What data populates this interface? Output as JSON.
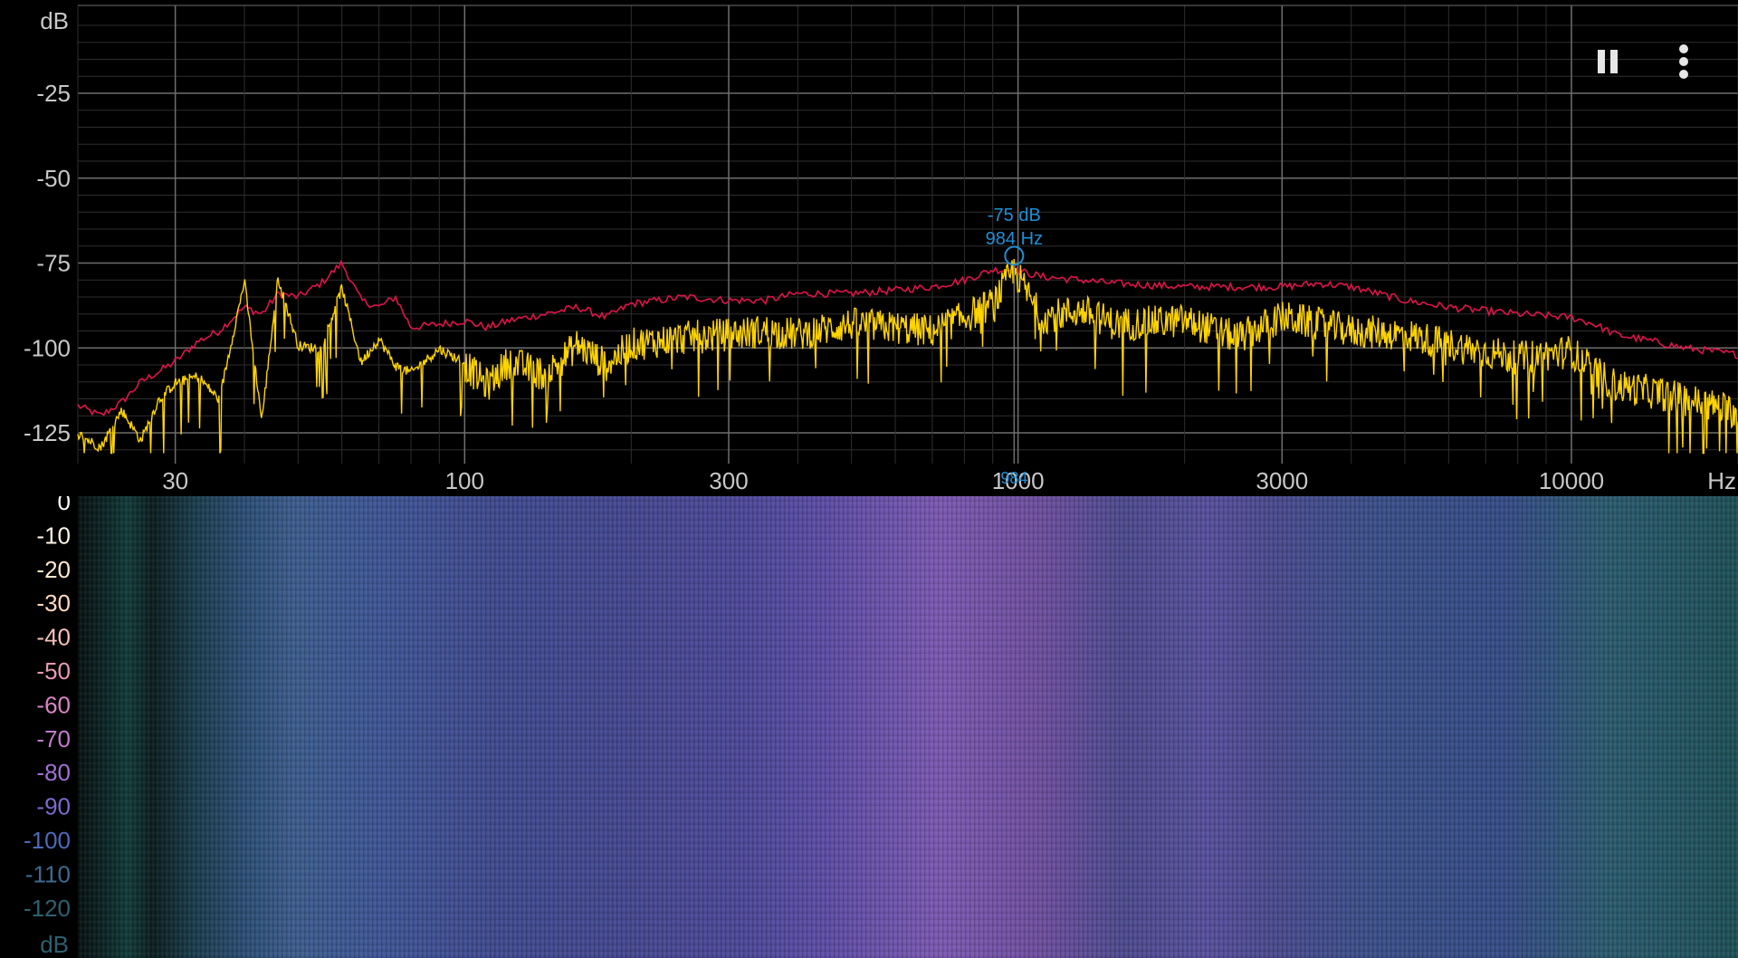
{
  "colors": {
    "peak_hold": "#e0134a",
    "spectrum": "#ffd400",
    "cursor": "#1e90d6",
    "grid_major": "#6e6e6e",
    "grid_minor": "#2e2e2e",
    "axis_text": "#c8c8c8"
  },
  "spectrum": {
    "y_unit": "dB",
    "x_unit": "Hz",
    "y_ticks": [
      "-25",
      "-50",
      "-75",
      "-100",
      "-125"
    ],
    "x_ticks": [
      "30",
      "100",
      "300",
      "1000",
      "3000",
      "10000"
    ],
    "cursor": {
      "db_label": "-75 dB",
      "hz_label": "984 Hz",
      "axis_marker": "984"
    }
  },
  "spectrogram": {
    "scale_labels": [
      "0",
      "-10",
      "-20",
      "-30",
      "-40",
      "-50",
      "-60",
      "-70",
      "-80",
      "-90",
      "-100",
      "-110",
      "-120"
    ],
    "unit": "dB",
    "scale_colors": [
      "#ffffff",
      "#fff6e8",
      "#ffe8d0",
      "#ffd8c0",
      "#f6c0b8",
      "#e89ab8",
      "#d884c4",
      "#c07ccc",
      "#a070d4",
      "#7c6ad0",
      "#4e6aba",
      "#3e6a90",
      "#2e6070"
    ]
  },
  "controls": {
    "pause_icon": "pause-icon",
    "menu_icon": "more-vert-icon"
  },
  "chart_data": {
    "type": "line",
    "xlabel": "Hz",
    "ylabel": "dB",
    "xscale": "log",
    "xlim": [
      20,
      20000
    ],
    "ylim": [
      -130,
      0
    ],
    "series": [
      {
        "x": [
          20,
          22,
          24,
          26,
          28,
          30,
          33,
          36,
          40,
          43,
          46,
          50,
          55,
          60,
          65,
          70,
          75,
          80,
          90,
          100,
          110,
          120,
          140,
          160,
          180,
          200,
          250,
          300,
          350,
          400,
          500,
          600,
          700,
          800,
          900,
          984,
          1100,
          1300,
          1500,
          2000,
          2500,
          3000,
          3500,
          4000,
          5000,
          6000,
          8000,
          10000,
          11000,
          12000,
          14000,
          16000,
          18000,
          20000
        ],
        "y": [
          -117,
          -120,
          -116,
          -110,
          -107,
          -104,
          -98,
          -95,
          -88,
          -90,
          -84,
          -85,
          -81,
          -75,
          -86,
          -88,
          -85,
          -94,
          -93,
          -92,
          -94,
          -92,
          -90,
          -88,
          -91,
          -87,
          -85,
          -86,
          -86,
          -84,
          -84,
          -83,
          -82,
          -80,
          -77,
          -77,
          -79,
          -80,
          -81,
          -82,
          -82,
          -82,
          -81,
          -82,
          -86,
          -88,
          -90,
          -91,
          -93,
          -96,
          -98,
          -100,
          -101,
          -102
        ]
      },
      {
        "x": [
          20,
          22,
          24,
          26,
          28,
          30,
          33,
          36,
          40,
          43,
          46,
          50,
          55,
          60,
          65,
          70,
          75,
          80,
          90,
          100,
          110,
          120,
          140,
          160,
          180,
          200,
          250,
          300,
          350,
          400,
          500,
          600,
          700,
          800,
          900,
          984,
          1100,
          1300,
          1500,
          2000,
          2500,
          3000,
          3500,
          4000,
          5000,
          6000,
          8000,
          10000,
          11000,
          12000,
          14000,
          16000,
          18000,
          20000
        ],
        "y": [
          -125,
          -129,
          -118,
          -127,
          -115,
          -110,
          -108,
          -115,
          -80,
          -121,
          -79,
          -99,
          -100,
          -82,
          -104,
          -97,
          -105,
          -107,
          -100,
          -104,
          -110,
          -103,
          -107,
          -98,
          -104,
          -98,
          -96,
          -95,
          -94,
          -95,
          -92,
          -93,
          -94,
          -90,
          -86,
          -76,
          -90,
          -88,
          -92,
          -91,
          -96,
          -90,
          -92,
          -94,
          -95,
          -98,
          -102,
          -100,
          -106,
          -110,
          -112,
          -114,
          -116,
          -118
        ]
      }
    ]
  }
}
